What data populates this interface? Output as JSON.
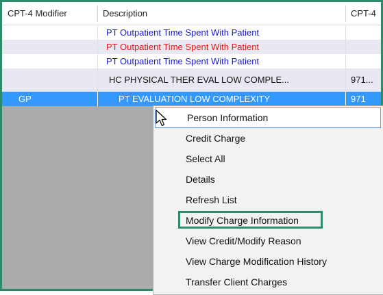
{
  "columns": [
    {
      "label": "CPT-4 Modifier"
    },
    {
      "label": "Description"
    },
    {
      "label": "CPT-4"
    }
  ],
  "rows": [
    {
      "modifier": "",
      "description": "PT Outpatient Time Spent With Patient",
      "cpt": "",
      "color": "#1a1ad6"
    },
    {
      "modifier": "",
      "description": "PT Outpatient Time Spent With Patient",
      "cpt": "",
      "color": "#e81818"
    },
    {
      "modifier": "",
      "description": "PT Outpatient Time Spent With Patient",
      "cpt": "",
      "color": "#1a1ad6"
    },
    {
      "modifier": "",
      "description": "HC PHYSICAL THER EVAL LOW COMPLE...",
      "cpt": "971...",
      "color": "#111111"
    },
    {
      "modifier": "GP",
      "description": "PT EVALUATION LOW COMPLEXITY",
      "cpt": "971",
      "color": "#ffffff",
      "selected": true
    }
  ],
  "context_menu": {
    "items": [
      {
        "label": "Person Information"
      },
      {
        "label": "Credit Charge"
      },
      {
        "label": "Select All"
      },
      {
        "label": "Details"
      },
      {
        "label": "Refresh List"
      },
      {
        "label": "Modify Charge Information"
      },
      {
        "label": "View Credit/Modify Reason"
      },
      {
        "label": "View Charge Modification History"
      },
      {
        "label": "Transfer Client Charges"
      }
    ]
  },
  "colors": {
    "frame": "#2e8b6a",
    "selection": "#3399ff",
    "row_alt": "#e8e8f2",
    "grid_empty": "#ababab"
  },
  "icons": {
    "cursor": "arrow-cursor-icon"
  }
}
